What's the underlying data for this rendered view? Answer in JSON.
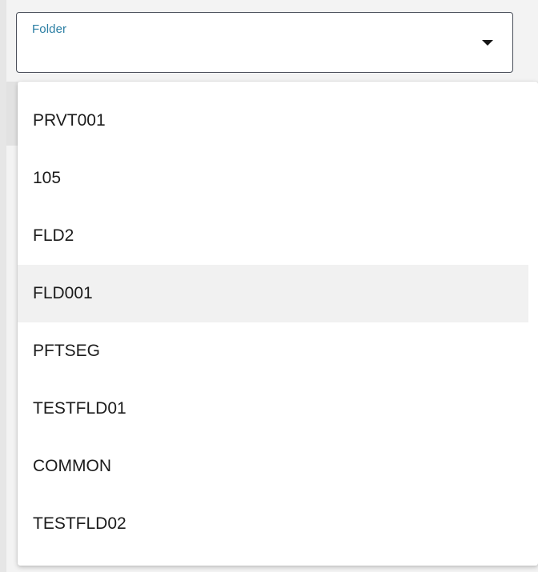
{
  "folder_select": {
    "label": "Folder",
    "selected_value": "",
    "options": [
      {
        "label": "PRVT001",
        "hovered": false
      },
      {
        "label": "105",
        "hovered": false
      },
      {
        "label": "FLD2",
        "hovered": false
      },
      {
        "label": "FLD001",
        "hovered": true
      },
      {
        "label": "PFTSEG",
        "hovered": false
      },
      {
        "label": "TESTFLD01",
        "hovered": false
      },
      {
        "label": "COMMON",
        "hovered": false
      },
      {
        "label": "TESTFLD02",
        "hovered": false
      }
    ]
  },
  "colors": {
    "label_accent": "#2a7ea3",
    "hover_background": "#f1f1f1",
    "field_border": "#4a4f5a"
  },
  "icons": {
    "dropdown_arrow": "caret-down-icon"
  }
}
